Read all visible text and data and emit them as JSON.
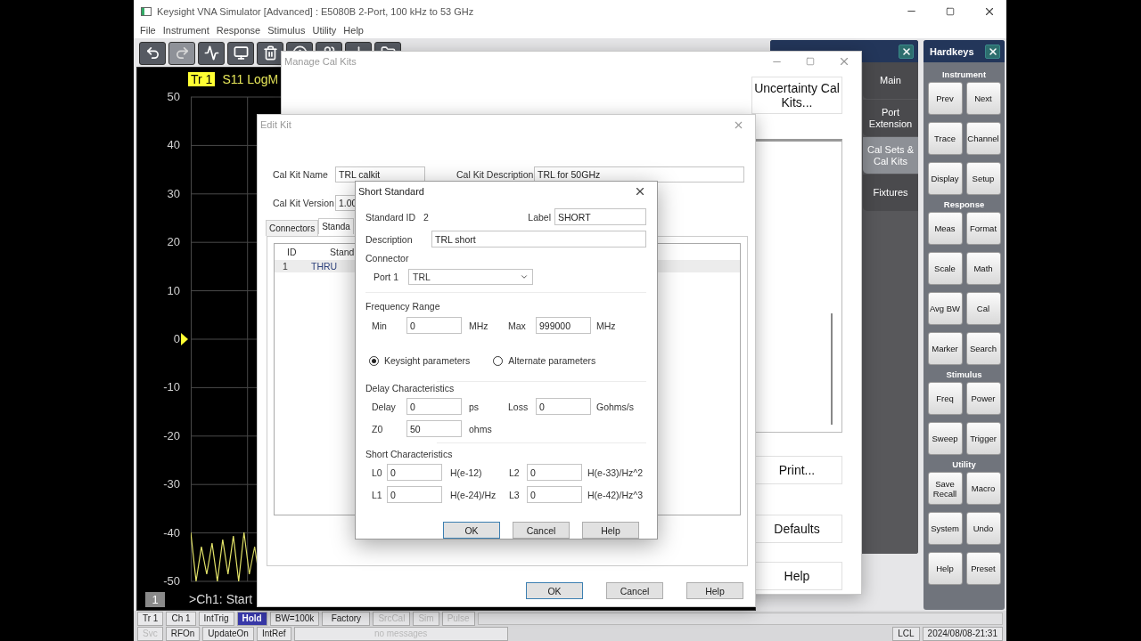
{
  "app_window": {
    "title": "Keysight VNA Simulator [Advanced] : E5080B 2-Port, 100 kHz to 53 GHz"
  },
  "menu": [
    "File",
    "Instrument",
    "Response",
    "Stimulus",
    "Utility",
    "Help"
  ],
  "toolbar": [
    {
      "kind": "undo",
      "disabled": false
    },
    {
      "kind": "redo",
      "disabled": true
    },
    {
      "kind": "add_trace",
      "disabled": false
    },
    {
      "kind": "screen",
      "disabled": false
    },
    {
      "kind": "delete",
      "disabled": false
    },
    {
      "kind": "upload",
      "disabled": false
    },
    {
      "kind": "link",
      "disabled": false
    },
    {
      "kind": "download",
      "disabled": false
    },
    {
      "kind": "folder",
      "disabled": false
    }
  ],
  "trace_window": {
    "trace_badge": "Tr 1",
    "measurement": "S11 LogM",
    "y_ticks": [
      "50",
      "40",
      "30",
      "20",
      "10",
      "0",
      "-10",
      "-20",
      "-30",
      "-40",
      "-50"
    ],
    "window_number": "1",
    "channel_status": ">Ch1: Start"
  },
  "cal_panel": {
    "tabs": [
      {
        "label": "Main",
        "selected": false
      },
      {
        "label": "Port Extension",
        "selected": false
      },
      {
        "label": "Cal Sets & Cal Kits",
        "selected": true
      },
      {
        "label": "Fixtures",
        "selected": false
      }
    ]
  },
  "hardkeys": {
    "title": "Hardkeys",
    "groups": [
      {
        "title": "Instrument",
        "keys": [
          "Prev",
          "Next",
          "Trace",
          "Channel",
          "Display",
          "Setup"
        ]
      },
      {
        "title": "Response",
        "keys": [
          "Meas",
          "Format",
          "Scale",
          "Math",
          "Avg BW",
          "Cal",
          "Marker",
          "Search"
        ]
      },
      {
        "title": "Stimulus",
        "keys": [
          "Freq",
          "Power",
          "Sweep",
          "Trigger"
        ]
      },
      {
        "title": "Utility",
        "keys": [
          "Save Recall",
          "Macro",
          "System",
          "Undo",
          "Help",
          "Preset"
        ]
      }
    ]
  },
  "status_bar": {
    "row_1": [
      {
        "label": "Tr 1",
        "highlighted": false,
        "disabled": false
      },
      {
        "label": "Ch 1",
        "highlighted": false,
        "disabled": false
      },
      {
        "label": "IntTrig",
        "highlighted": false,
        "disabled": false
      },
      {
        "label": "Hold",
        "highlighted": true,
        "disabled": false
      },
      {
        "label": "BW=100k",
        "highlighted": false,
        "disabled": false
      },
      {
        "label": "Factory",
        "highlighted": false,
        "disabled": false
      },
      {
        "label": "SrcCal",
        "highlighted": false,
        "disabled": true
      },
      {
        "label": "Sim",
        "highlighted": false,
        "disabled": true
      },
      {
        "label": "Pulse",
        "highlighted": false,
        "disabled": true
      }
    ],
    "row_2": [
      {
        "label": "Svc",
        "highlighted": false,
        "disabled": true
      },
      {
        "label": "RFOn",
        "highlighted": false,
        "disabled": false
      },
      {
        "label": "UpdateOn",
        "highlighted": false,
        "disabled": false
      },
      {
        "label": "IntRef",
        "highlighted": false,
        "disabled": false
      },
      {
        "label": "no messages",
        "highlighted": false,
        "disabled": true
      }
    ],
    "remote": "LCL",
    "datetime": "2024/08/08-21:31"
  },
  "manage_cal_kits": {
    "title": "Manage Cal Kits",
    "buttons": [
      "Uncertainty Cal Kits...",
      "Print...",
      "Defaults",
      "Help"
    ]
  },
  "edit_kit": {
    "title": "Edit Kit",
    "fields": [
      {
        "label": "Cal Kit Name",
        "value": "TRL calkit"
      },
      {
        "label": "Cal Kit Description",
        "value": "TRL for 50GHz"
      },
      {
        "label": "Cal Kit Version",
        "value": "1.00"
      }
    ],
    "tabs": [
      {
        "label": "Connectors",
        "selected": false
      },
      {
        "label": "Standa",
        "selected": true
      }
    ],
    "table": {
      "columns": [
        "ID",
        "Stand"
      ],
      "rows": [
        {
          "cells": [
            "1",
            "THRU"
          ],
          "selected": true
        }
      ]
    },
    "buttons": [
      {
        "label": "OK",
        "default": true
      },
      {
        "label": "Cancel",
        "default": false
      },
      {
        "label": "Help",
        "default": false
      }
    ]
  },
  "short_standard": {
    "title": "Short Standard",
    "standard_id": {
      "label": "Standard ID",
      "value": "2"
    },
    "label_field": {
      "label": "Label",
      "value": "SHORT"
    },
    "description": {
      "label": "Description",
      "value": "TRL short"
    },
    "connector": {
      "heading": "Connector",
      "label": "Port 1",
      "value": "TRL"
    },
    "frequency_range": {
      "heading": "Frequency Range",
      "fields": [
        {
          "label": "Min",
          "value": "0",
          "unit": "MHz"
        },
        {
          "label": "Max",
          "value": "999000",
          "unit": "MHz"
        }
      ]
    },
    "parameter_options": [
      {
        "label": "Keysight parameters",
        "selected": true
      },
      {
        "label": "Alternate parameters",
        "selected": false
      }
    ],
    "delay": {
      "heading": "Delay Characteristics",
      "fields": [
        {
          "label": "Delay",
          "value": "0",
          "unit": "ps"
        },
        {
          "label": "Loss",
          "value": "0",
          "unit": "Gohms/s"
        },
        {
          "label": "Z0",
          "value": "50",
          "unit": "ohms"
        }
      ]
    },
    "short": {
      "heading": "Short Characteristics",
      "fields": [
        {
          "label": "L0",
          "value": "0",
          "unit": "H(e-12)"
        },
        {
          "label": "L2",
          "value": "0",
          "unit": "H(e-33)/Hz^2"
        },
        {
          "label": "L1",
          "value": "0",
          "unit": "H(e-24)/Hz"
        },
        {
          "label": "L3",
          "value": "0",
          "unit": "H(e-42)/Hz^3"
        }
      ]
    },
    "buttons": [
      {
        "label": "OK",
        "default": true
      },
      {
        "label": "Cancel",
        "default": false
      },
      {
        "label": "Help",
        "default": false
      }
    ]
  }
}
